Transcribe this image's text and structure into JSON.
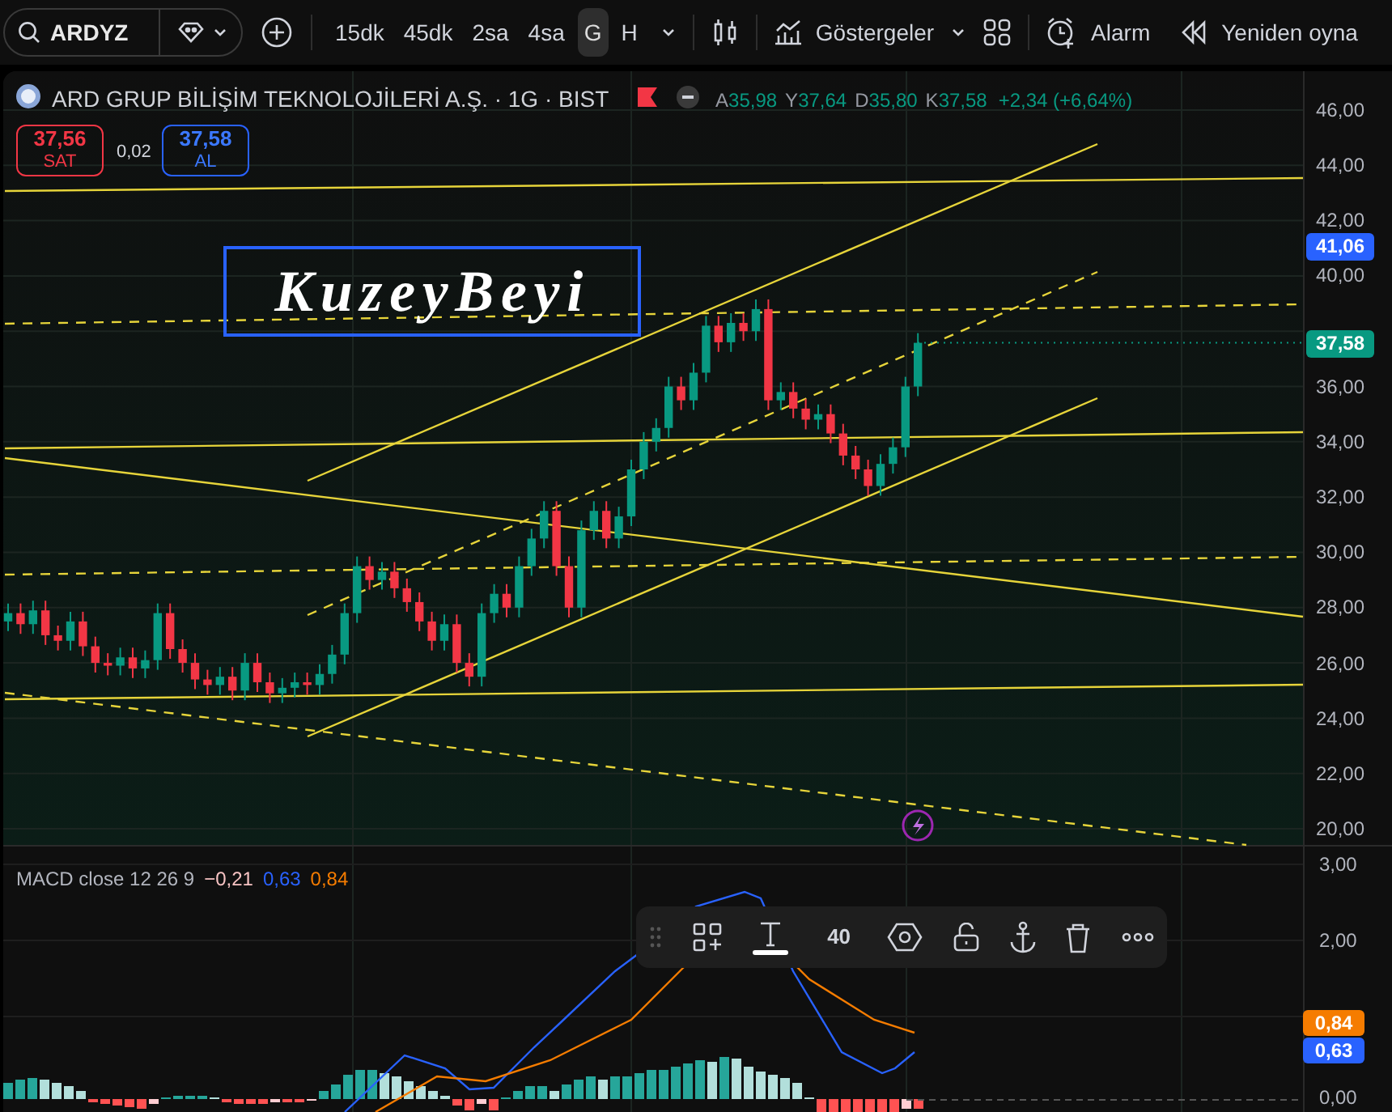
{
  "toolbar": {
    "symbol": "ARDYZ",
    "intervals": [
      {
        "label": "15dk",
        "selected": false
      },
      {
        "label": "45dk",
        "selected": false
      },
      {
        "label": "2sa",
        "selected": false
      },
      {
        "label": "4sa",
        "selected": false
      },
      {
        "label": "G",
        "selected": true
      },
      {
        "label": "H",
        "selected": false
      }
    ],
    "indicators_label": "Göstergeler",
    "alarm_label": "Alarm",
    "replay_label": "Yeniden oyna"
  },
  "legend": {
    "title": "ARD GRUP BİLİŞİM TEKNOLOJİLERİ A.Ş. · 1G · BIST",
    "ohlc": [
      {
        "key": "A",
        "value": "35,98"
      },
      {
        "key": "Y",
        "value": "37,64"
      },
      {
        "key": "D",
        "value": "35,80"
      },
      {
        "key": "K",
        "value": "37,58"
      }
    ],
    "change": "+2,34 (+6,64%)",
    "sell": {
      "price": "37,56",
      "label": "SAT"
    },
    "spread": "0,02",
    "buy": {
      "price": "37,58",
      "label": "AL"
    }
  },
  "text_drawing": {
    "text": "KuzeyBeyi"
  },
  "price_axis": {
    "labels": [
      "46,00",
      "44,00",
      "42,00",
      "40,00",
      "36,00",
      "34,00",
      "32,00",
      "30,00",
      "28,00",
      "26,00",
      "24,00",
      "22,00",
      "20,00"
    ],
    "badges": [
      {
        "text": "41,06",
        "color": "#2962ff"
      },
      {
        "text": "37,58",
        "color": "#089981"
      }
    ]
  },
  "macd": {
    "title": "MACD close 12 26 9",
    "values": [
      {
        "text": "−0,21",
        "color": "#f8c4c4"
      },
      {
        "text": "0,63",
        "color": "#2962ff"
      },
      {
        "text": "0,84",
        "color": "#f57c00"
      }
    ],
    "axis_labels": [
      "3,00",
      "2,00",
      "0,00"
    ],
    "badges": [
      {
        "text": "0,84",
        "color": "#f57c00"
      },
      {
        "text": "0,63",
        "color": "#2962ff"
      }
    ]
  },
  "drawing_toolbar": {
    "font_size": "40"
  }
}
